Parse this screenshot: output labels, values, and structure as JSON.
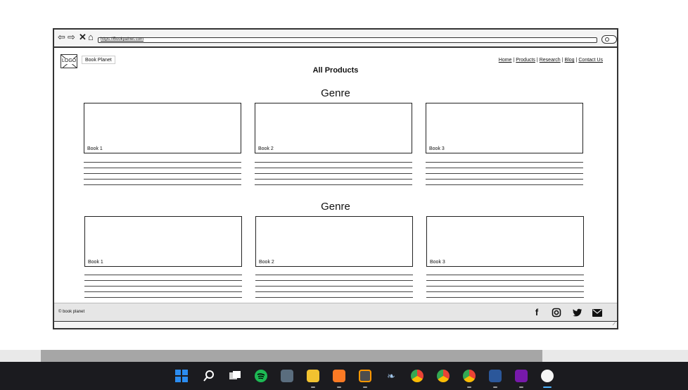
{
  "browser": {
    "url": "https://Bookpalnet.com",
    "nav_icons": [
      "back-arrow-icon",
      "forward-arrow-icon",
      "close-icon",
      "home-icon"
    ]
  },
  "header": {
    "logo_text": "LOGO",
    "brand": "Book Planet",
    "nav": [
      "Home",
      "Products",
      "Research",
      "Blog",
      "Contact Us"
    ],
    "nav_separator": "|"
  },
  "page": {
    "title": "All Products",
    "sections": [
      {
        "heading": "Genre",
        "books": [
          "Book 1",
          "Book 2",
          "Book 3"
        ]
      },
      {
        "heading": "Genre",
        "books": [
          "Book 1",
          "Book 2",
          "Book 3"
        ]
      }
    ]
  },
  "footer": {
    "copyright": "book planet",
    "copyright_symbol": "©",
    "social_icons": [
      "facebook-icon",
      "instagram-icon",
      "twitter-icon",
      "email-icon"
    ]
  },
  "taskbar": {
    "icons": [
      "windows-start-icon",
      "search-icon",
      "task-view-icon",
      "spotify-icon",
      "recycle-bin-icon",
      "file-explorer-icon",
      "xampp-icon",
      "sublime-text-icon",
      "mysql-workbench-icon",
      "chrome-dev-icon",
      "chrome-icon",
      "chrome-profile-icon",
      "word-icon",
      "onenote-icon",
      "emoji-icon"
    ]
  },
  "colors": {
    "taskbar_bg": "#1b1b1f",
    "windows_blue": "#2b8cf0",
    "spotify_green": "#1db954",
    "word_blue": "#2b579a",
    "onenote_purple": "#7719aa",
    "xampp_orange": "#fb7a24"
  }
}
